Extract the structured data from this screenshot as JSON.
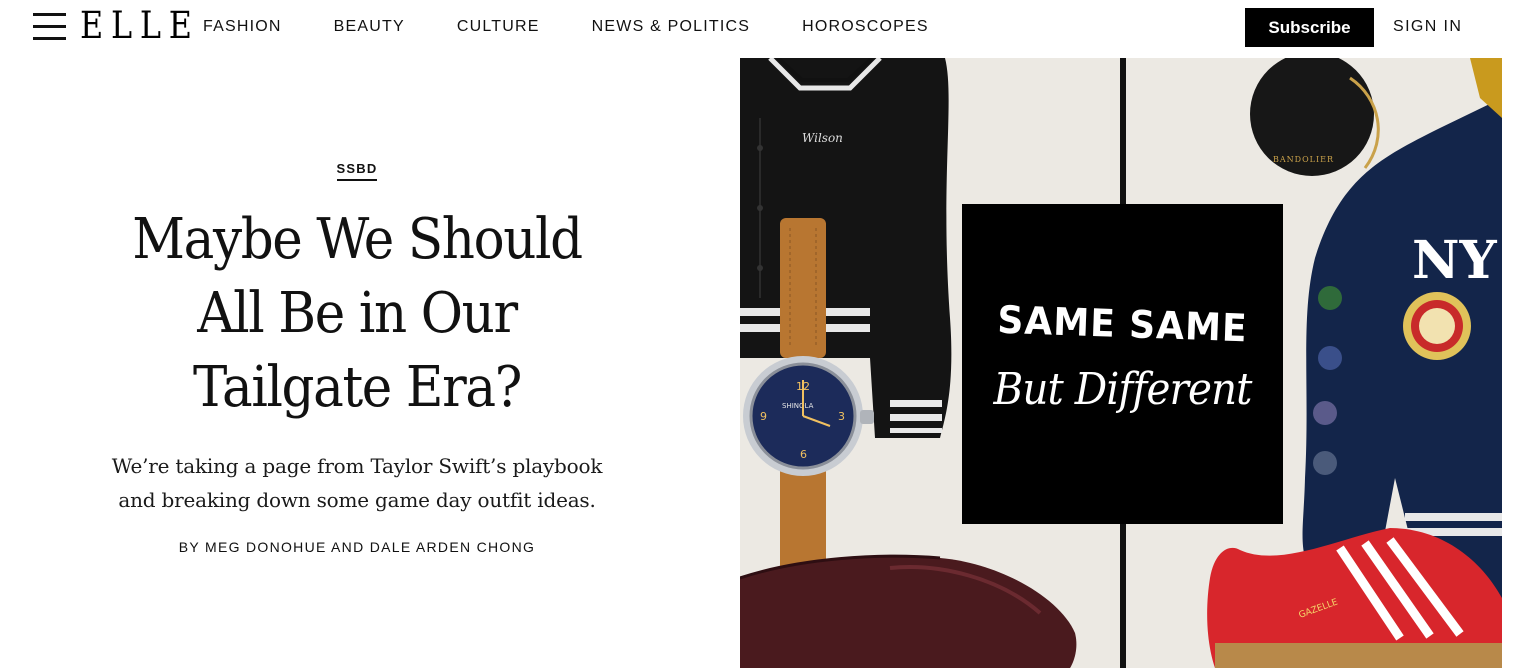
{
  "header": {
    "logo": "ELLE",
    "nav": [
      "FASHION",
      "BEAUTY",
      "CULTURE",
      "NEWS & POLITICS",
      "HOROSCOPES"
    ],
    "subscribe_label": "Subscribe",
    "signin_label": "SIGN IN"
  },
  "article": {
    "kicker": "SSBD",
    "headline_lines": [
      "Maybe We Should",
      "All Be in Our",
      "Tailgate Era?"
    ],
    "dek_lines": [
      "We’re taking a page from Taylor Swift’s playbook",
      "and breaking down some game day outfit ideas."
    ],
    "byline": "BY MEG DONOHUE AND DALE ARDEN CHONG"
  },
  "hero": {
    "badge_line1": "SAME SAME",
    "badge_line2": "But Different",
    "pouch_brand": "BANDOLIER",
    "jacket_patch": "Wilson",
    "watch_brand": "SHINOLA",
    "shoe_text": "GAZELLE",
    "colors": {
      "background": "#ece9e3",
      "varsity_jacket": "#141414",
      "navy_jacket": "#13254a",
      "sneaker_red": "#d8262c",
      "loafer": "#4a1a1e",
      "watch_strap": "#b87631",
      "watch_dial": "#1c2b5a"
    }
  }
}
